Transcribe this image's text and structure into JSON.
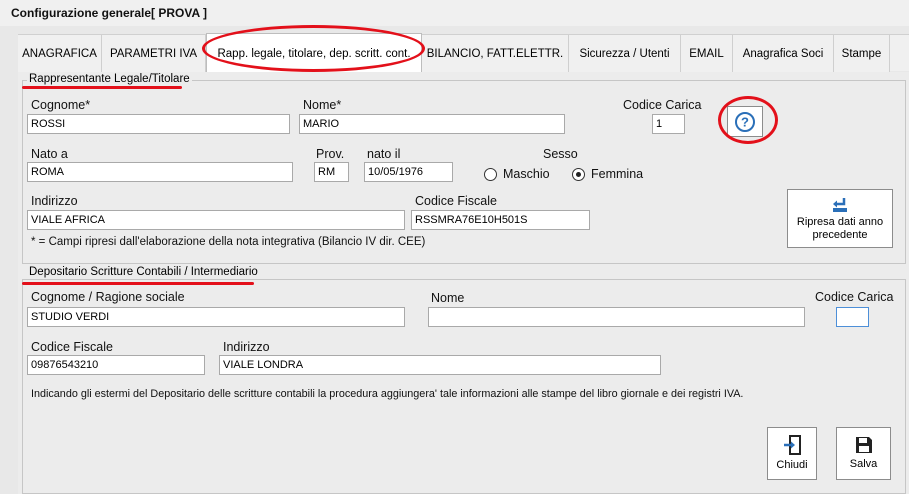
{
  "window": {
    "title": "Configurazione generale",
    "company": "[ PROVA ]"
  },
  "tabs": [
    {
      "label": "ANAGRAFICA"
    },
    {
      "label": "PARAMETRI IVA"
    },
    {
      "label": "Rapp. legale, titolare, dep. scritt. cont."
    },
    {
      "label": "BILANCIO, FATT.ELETTR."
    },
    {
      "label": "Sicurezza / Utenti"
    },
    {
      "label": "EMAIL"
    },
    {
      "label": "Anagrafica Soci"
    },
    {
      "label": "Stampe"
    }
  ],
  "legal_rep": {
    "group_title": "Rappresentante Legale/Titolare",
    "cognome_label": "Cognome*",
    "cognome_value": "ROSSI",
    "nome_label": "Nome*",
    "nome_value": "MARIO",
    "codice_carica_label": "Codice Carica",
    "codice_carica_value": "1",
    "nato_a_label": "Nato a",
    "nato_a_value": "ROMA",
    "prov_label": "Prov.",
    "prov_value": "RM",
    "nato_il_label": "nato il",
    "nato_il_value": "10/05/1976",
    "sesso_label": "Sesso",
    "maschio_label": "Maschio",
    "femmina_label": "Femmina",
    "sesso_selected": "Femmina",
    "indirizzo_label": "Indirizzo",
    "indirizzo_value": "VIALE AFRICA",
    "codice_fiscale_label": "Codice Fiscale",
    "codice_fiscale_value": "RSSMRA76E10H501S",
    "note": "* = Campi ripresi dall'elaborazione della nota integrativa (Bilancio IV dir. CEE)",
    "ripresa_button": "Ripresa dati anno precedente"
  },
  "depositario": {
    "group_title": "Depositario Scritture Contabili / Intermediario",
    "cognome_label": "Cognome / Ragione sociale",
    "cognome_value": "STUDIO VERDI",
    "nome_label": "Nome",
    "nome_value": "",
    "codice_carica_label": "Codice Carica",
    "codice_carica_value": "",
    "codice_fiscale_label": "Codice Fiscale",
    "codice_fiscale_value": "09876543210",
    "indirizzo_label": "Indirizzo",
    "indirizzo_value": "VIALE LONDRA",
    "info": "Indicando gli estermi del Depositario delle scritture contabili la procedura aggiungera' tale informazioni alle stampe del libro giornale e dei registri IVA."
  },
  "footer": {
    "close_label": "Chiudi",
    "save_label": "Salva"
  },
  "colors": {
    "highlight": "#e3101a",
    "help_icon": "#2a6fb8"
  }
}
